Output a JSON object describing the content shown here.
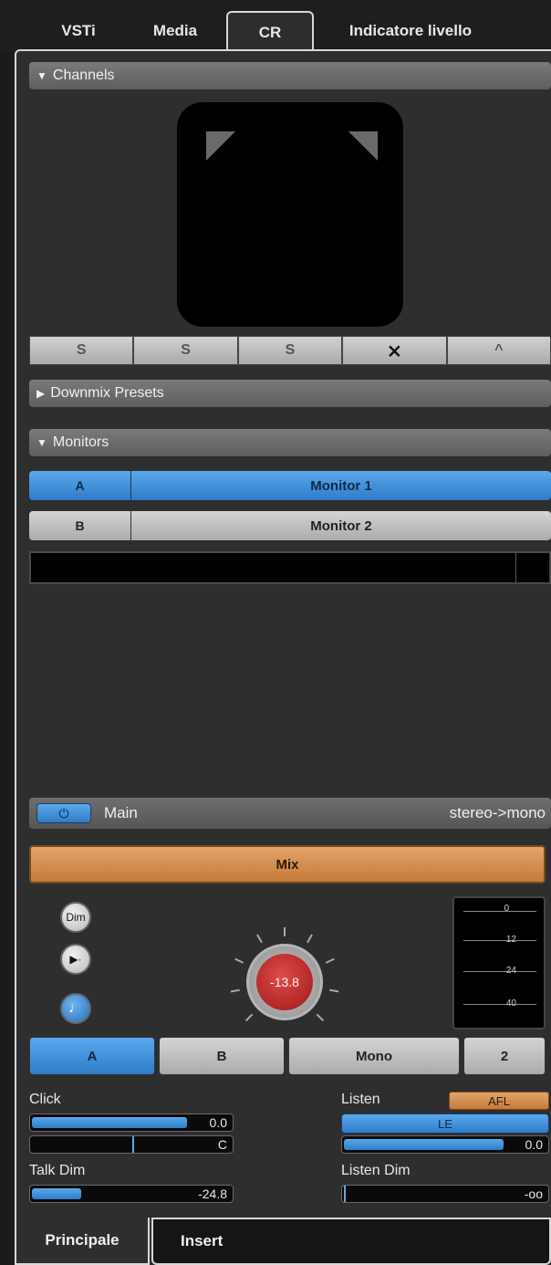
{
  "tabs": [
    "VSTi",
    "Media",
    "CR",
    "Indicatore livello"
  ],
  "active_tab": "CR",
  "sections": {
    "channels": "Channels",
    "downmix": "Downmix Presets",
    "monitors": "Monitors"
  },
  "monitors": [
    {
      "letter": "A",
      "name": "Monitor 1",
      "selected": true
    },
    {
      "letter": "B",
      "name": "Monitor 2",
      "selected": false
    }
  ],
  "main": {
    "label": "Main",
    "routing": "stereo->mono",
    "power_icon": "power-icon"
  },
  "mix": {
    "label": "Mix"
  },
  "side_buttons": {
    "dim": "Dim"
  },
  "knob": {
    "value": "-13.8"
  },
  "meter": {
    "marks": [
      "0",
      "12",
      "24",
      "40"
    ]
  },
  "selectors": {
    "a": "A",
    "b": "B",
    "mono": "Mono",
    "num": "2"
  },
  "click": {
    "label": "Click",
    "level": "0.0",
    "pan": "C",
    "level_fill": 0.85
  },
  "talk_dim": {
    "label": "Talk Dim",
    "value": "-24.8",
    "fill": 0.25
  },
  "listen": {
    "label": "Listen",
    "mode": "AFL",
    "le": "LE",
    "level": "0.0",
    "level_fill": 0.78
  },
  "listen_dim": {
    "label": "Listen Dim",
    "value": "-oo"
  },
  "bottom_tabs": [
    "Principale",
    "Insert"
  ],
  "colors": {
    "accent_blue": "#3d8ddb",
    "accent_orange": "#d98c4a",
    "knob_red": "#c42a2a"
  }
}
